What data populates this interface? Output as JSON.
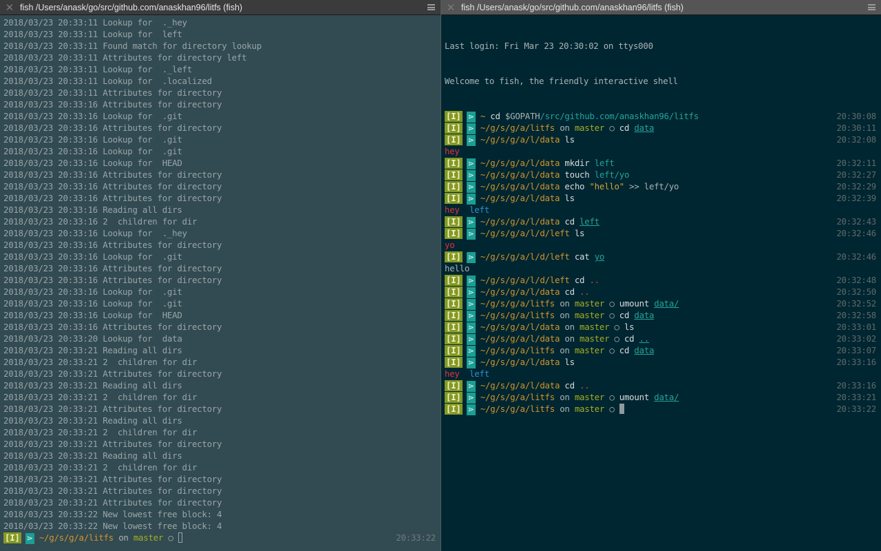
{
  "left_pane": {
    "title": "fish  /Users/anask/go/src/github.com/anaskhan96/litfs (fish)",
    "log_lines": [
      "2018/03/23 20:33:11 Lookup for  ._hey",
      "2018/03/23 20:33:11 Lookup for  left",
      "2018/03/23 20:33:11 Found match for directory lookup",
      "2018/03/23 20:33:11 Attributes for directory left",
      "2018/03/23 20:33:11 Lookup for  ._left",
      "2018/03/23 20:33:11 Lookup for  .localized",
      "2018/03/23 20:33:11 Attributes for directory",
      "2018/03/23 20:33:16 Attributes for directory",
      "2018/03/23 20:33:16 Lookup for  .git",
      "2018/03/23 20:33:16 Attributes for directory",
      "2018/03/23 20:33:16 Lookup for  .git",
      "2018/03/23 20:33:16 Lookup for  .git",
      "2018/03/23 20:33:16 Lookup for  HEAD",
      "2018/03/23 20:33:16 Attributes for directory",
      "2018/03/23 20:33:16 Attributes for directory",
      "2018/03/23 20:33:16 Attributes for directory",
      "2018/03/23 20:33:16 Reading all dirs",
      "2018/03/23 20:33:16 2  children for dir",
      "2018/03/23 20:33:16 Lookup for  ._hey",
      "2018/03/23 20:33:16 Attributes for directory",
      "2018/03/23 20:33:16 Lookup for  .git",
      "2018/03/23 20:33:16 Attributes for directory",
      "2018/03/23 20:33:16 Attributes for directory",
      "2018/03/23 20:33:16 Lookup for  .git",
      "2018/03/23 20:33:16 Lookup for  .git",
      "2018/03/23 20:33:16 Lookup for  HEAD",
      "2018/03/23 20:33:16 Attributes for directory",
      "2018/03/23 20:33:20 Lookup for  data",
      "2018/03/23 20:33:21 Reading all dirs",
      "2018/03/23 20:33:21 2  children for dir",
      "2018/03/23 20:33:21 Attributes for directory",
      "2018/03/23 20:33:21 Reading all dirs",
      "2018/03/23 20:33:21 2  children for dir",
      "2018/03/23 20:33:21 Attributes for directory",
      "2018/03/23 20:33:21 Reading all dirs",
      "2018/03/23 20:33:21 2  children for dir",
      "2018/03/23 20:33:21 Attributes for directory",
      "2018/03/23 20:33:21 Reading all dirs",
      "2018/03/23 20:33:21 2  children for dir",
      "2018/03/23 20:33:21 Attributes for directory",
      "2018/03/23 20:33:21 Attributes for directory",
      "2018/03/23 20:33:21 Attributes for directory",
      "2018/03/23 20:33:22 New lowest free block: 4",
      "2018/03/23 20:33:22 New lowest free block: 4"
    ],
    "prompt": {
      "mode": "[I]",
      "arrow": "⋗",
      "cwd": "~/g/s/g/a/litfs",
      "on": "on",
      "branch": "master",
      "dirty": "○",
      "time": "20:33:22"
    }
  },
  "right_pane": {
    "title": "fish  /Users/anask/go/src/github.com/anaskhan96/litfs (fish)",
    "last_login": "Last login: Fri Mar 23 20:30:02 on ttys000",
    "welcome": "Welcome to fish, the friendly interactive shell",
    "mode_label": "[I]",
    "arrow_glyph": "⋗",
    "lines": [
      {
        "type": "prompt",
        "cwd": "~",
        "cmd": "cd",
        "args": [
          {
            "t": "$GOPATH",
            "s": "dim"
          },
          {
            "t": "/src/github.com/anaskhan96/litfs",
            "s": "argp"
          }
        ],
        "time": "20:30:08"
      },
      {
        "type": "prompt",
        "cwd": "~/g/s/g/a/litfs",
        "branch": "master",
        "cmd": "cd",
        "args": [
          {
            "t": "data",
            "s": "argu"
          }
        ],
        "time": "20:30:11"
      },
      {
        "type": "prompt",
        "cwd": "~/g/s/g/a/l/data",
        "cmd": "ls",
        "args": [],
        "time": "20:32:08"
      },
      {
        "type": "output",
        "parts": [
          {
            "t": "hey",
            "s": "fileout"
          }
        ]
      },
      {
        "type": "prompt",
        "cwd": "~/g/s/g/a/l/data",
        "cmd": "mkdir",
        "args": [
          {
            "t": "left",
            "s": "argp"
          }
        ],
        "time": "20:32:11"
      },
      {
        "type": "prompt",
        "cwd": "~/g/s/g/a/l/data",
        "cmd": "touch",
        "args": [
          {
            "t": "left/yo",
            "s": "argp"
          }
        ],
        "time": "20:32:27"
      },
      {
        "type": "prompt",
        "cwd": "~/g/s/g/a/l/data",
        "cmd": "echo",
        "args": [
          {
            "t": "\"hello\"",
            "s": "str"
          },
          {
            "t": ">> left/yo",
            "s": "dim"
          }
        ],
        "time": "20:32:29"
      },
      {
        "type": "prompt",
        "cwd": "~/g/s/g/a/l/data",
        "cmd": "ls",
        "args": [],
        "time": "20:32:39"
      },
      {
        "type": "output",
        "parts": [
          {
            "t": "hey",
            "s": "fileout"
          },
          {
            "t": "  ",
            "s": "dim"
          },
          {
            "t": "left",
            "s": "dirout"
          }
        ]
      },
      {
        "type": "prompt",
        "cwd": "~/g/s/g/a/l/data",
        "cmd": "cd",
        "args": [
          {
            "t": "left",
            "s": "argu"
          }
        ],
        "time": "20:32:43"
      },
      {
        "type": "prompt",
        "cwd": "~/g/s/g/a/l/d/left",
        "cmd": "ls",
        "args": [],
        "time": "20:32:46"
      },
      {
        "type": "output",
        "parts": [
          {
            "t": "yo",
            "s": "fileout"
          }
        ]
      },
      {
        "type": "prompt",
        "cwd": "~/g/s/g/a/l/d/left",
        "cmd": "cat",
        "args": [
          {
            "t": "yo",
            "s": "argu"
          }
        ],
        "time": "20:32:46"
      },
      {
        "type": "output",
        "parts": [
          {
            "t": "hello",
            "s": "dim"
          }
        ]
      },
      {
        "type": "prompt",
        "cwd": "~/g/s/g/a/l/d/left",
        "cmd": "cd",
        "args": [
          {
            "t": "..",
            "s": "err"
          }
        ],
        "time": "20:32:48"
      },
      {
        "type": "prompt",
        "cwd": "~/g/s/g/a/l/data",
        "cmd": "cd",
        "args": [
          {
            "t": "..",
            "s": "err"
          }
        ],
        "time": "20:32:50"
      },
      {
        "type": "prompt",
        "cwd": "~/g/s/g/a/litfs",
        "branch": "master",
        "cmd": "umount",
        "args": [
          {
            "t": "data/",
            "s": "argu"
          }
        ],
        "time": "20:32:52"
      },
      {
        "type": "prompt",
        "cwd": "~/g/s/g/a/litfs",
        "branch": "master",
        "cmd": "cd",
        "args": [
          {
            "t": "data",
            "s": "argu"
          }
        ],
        "time": "20:32:58"
      },
      {
        "type": "prompt",
        "cwd": "~/g/s/g/a/l/data",
        "branch": "master",
        "cmd": "ls",
        "args": [],
        "time": "20:33:01"
      },
      {
        "type": "prompt",
        "cwd": "~/g/s/g/a/l/data",
        "branch": "master",
        "cmd": "cd",
        "args": [
          {
            "t": "..",
            "s": "argu"
          }
        ],
        "time": "20:33:02"
      },
      {
        "type": "prompt",
        "cwd": "~/g/s/g/a/litfs",
        "branch": "master",
        "cmd": "cd",
        "args": [
          {
            "t": "data",
            "s": "argu"
          }
        ],
        "time": "20:33:07"
      },
      {
        "type": "prompt",
        "cwd": "~/g/s/g/a/l/data",
        "cmd": "ls",
        "args": [],
        "time": "20:33:16"
      },
      {
        "type": "output",
        "parts": [
          {
            "t": "hey",
            "s": "fileout"
          },
          {
            "t": "  ",
            "s": "dim"
          },
          {
            "t": "left",
            "s": "dirout"
          }
        ]
      },
      {
        "type": "prompt",
        "cwd": "~/g/s/g/a/l/data",
        "cmd": "cd",
        "args": [
          {
            "t": "..",
            "s": "err"
          }
        ],
        "time": "20:33:16"
      },
      {
        "type": "prompt",
        "cwd": "~/g/s/g/a/litfs",
        "branch": "master",
        "cmd": "umount",
        "args": [
          {
            "t": "data/",
            "s": "argu"
          }
        ],
        "time": "20:33:21"
      },
      {
        "type": "prompt",
        "cwd": "~/g/s/g/a/litfs",
        "branch": "master",
        "cmd": "",
        "args": [],
        "time": "20:33:22",
        "cursor": true
      }
    ],
    "on_label": "on",
    "dirty_glyph": "○"
  }
}
